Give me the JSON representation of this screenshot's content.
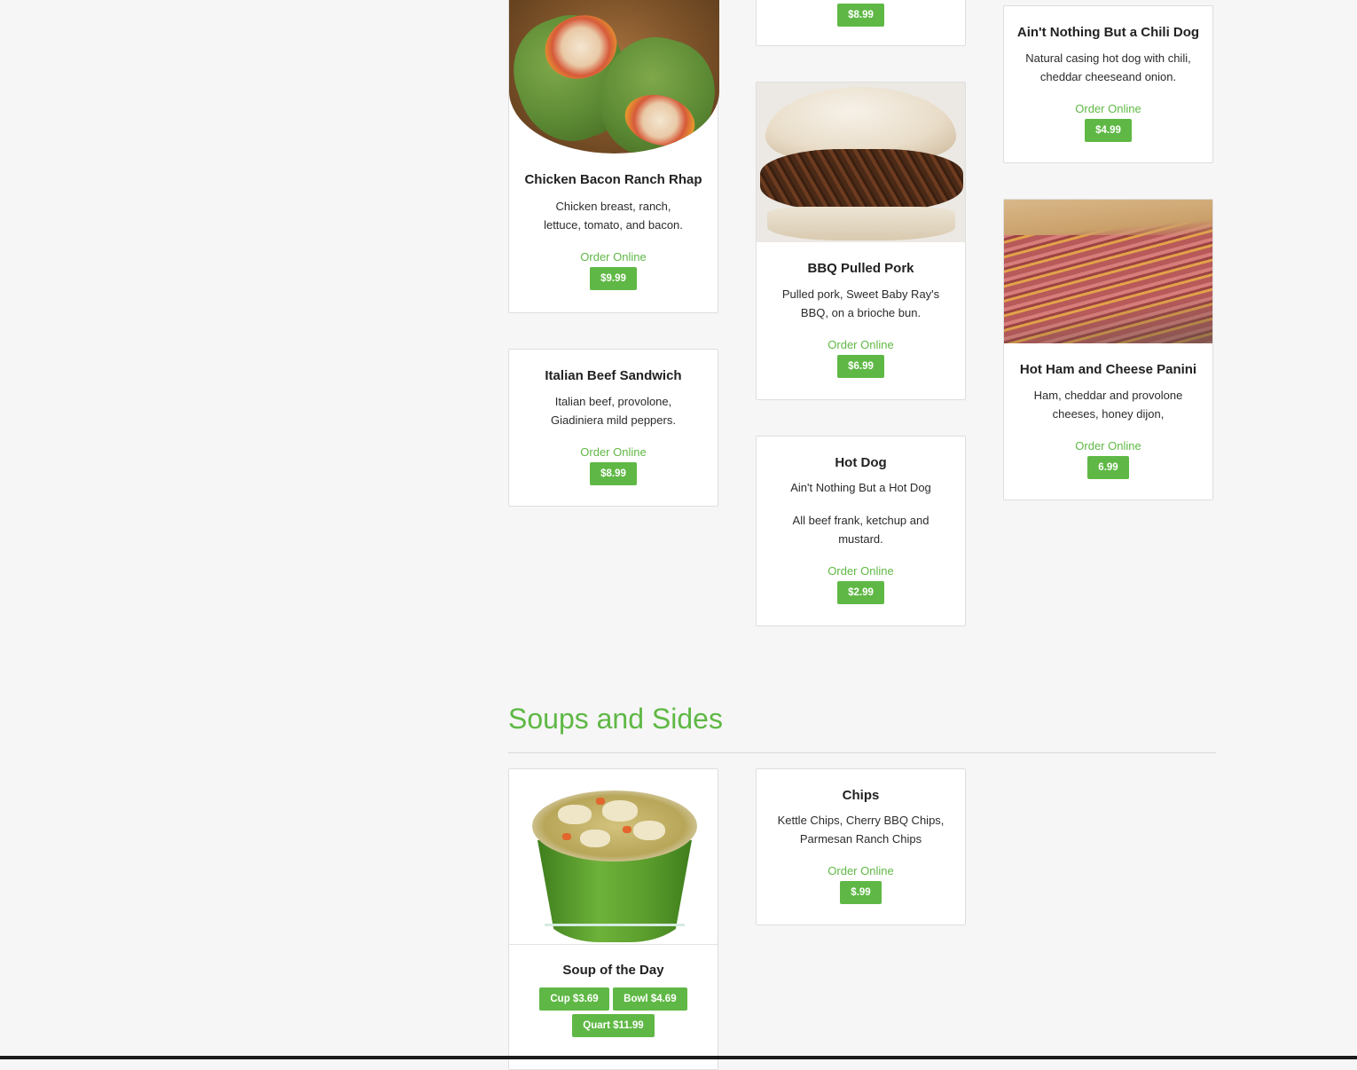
{
  "colors": {
    "accent": "#5fb845",
    "background": "#f6f6f6",
    "card": "#ffffff"
  },
  "top_card": {
    "price": "$8.99"
  },
  "chicken_wrap": {
    "image": "chicken-wrap-photo",
    "title": "Chicken Bacon Ranch Rhap",
    "desc": "Chicken breast, ranch, lettuce, tomato, and bacon.",
    "order": "Order Online",
    "price": "$9.99"
  },
  "chili_dog": {
    "title": "Ain't Nothing But a Chili Dog",
    "desc": "Natural casing hot dog with chili, cheddar cheeseand onion.",
    "order": "Order Online",
    "price": "$4.99"
  },
  "bbq_pork": {
    "image": "bbq-pulled-pork-photo",
    "title": "BBQ Pulled Pork",
    "desc": "Pulled pork, Sweet Baby Ray's BBQ, on a brioche bun.",
    "order": "Order Online",
    "price": "$6.99"
  },
  "ham_panini": {
    "image": "ham-cheese-panini-photo",
    "title": "Hot Ham and Cheese Panini",
    "desc": "Ham, cheddar and provolone cheeses, honey dijon,",
    "order": "Order Online",
    "price": "6.99"
  },
  "italian_beef": {
    "title": "Italian Beef Sandwich",
    "desc": "Italian beef, provolone, Giadiniera mild peppers.",
    "order": "Order Online",
    "price": "$8.99"
  },
  "hot_dog": {
    "title": "Hot Dog",
    "subtitle": "Ain't Nothing But a Hot Dog",
    "desc": "All beef frank, ketchup and mustard.",
    "order": "Order Online",
    "price": "$2.99"
  },
  "soups_section": {
    "title": "Soups and Sides"
  },
  "soup": {
    "image": "soup-bowl-photo",
    "title": "Soup of the Day",
    "cup": "Cup $3.69",
    "bowl": "Bowl $4.69",
    "quart": "Quart $11.99"
  },
  "chips": {
    "title": "Chips",
    "desc": "Kettle Chips, Cherry BBQ Chips, Parmesan Ranch Chips",
    "order": "Order Online",
    "price": "$.99"
  }
}
